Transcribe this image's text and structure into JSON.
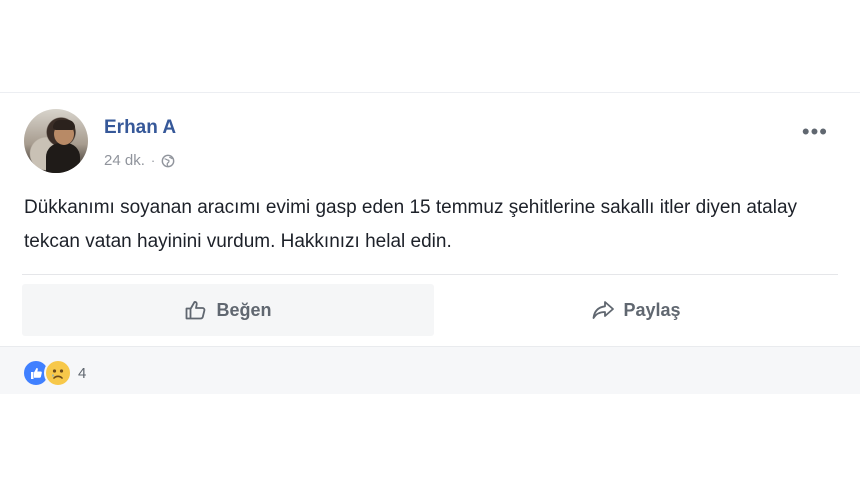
{
  "post": {
    "author": "Erhan A",
    "time": "24 dk.",
    "separator": "·",
    "privacy_icon": "globe-icon",
    "menu_icon": "more-options-icon",
    "text": "Dükkanımı soyanan aracımı evimi gasp eden 15 temmuz şehitlerine sakallı itler diyen atalay tekcan vatan hayinini vurdum. Hakkınızı helal edin."
  },
  "actions": {
    "like_label": "Beğen",
    "share_label": "Paylaş"
  },
  "reactions": {
    "icons": [
      "like-reaction-icon",
      "sad-reaction-icon"
    ],
    "count": "4"
  },
  "colors": {
    "author_link": "#365899",
    "like_blue": "#4080ff",
    "meta_gray": "#90949c",
    "footer_bg": "#f6f7f9"
  }
}
